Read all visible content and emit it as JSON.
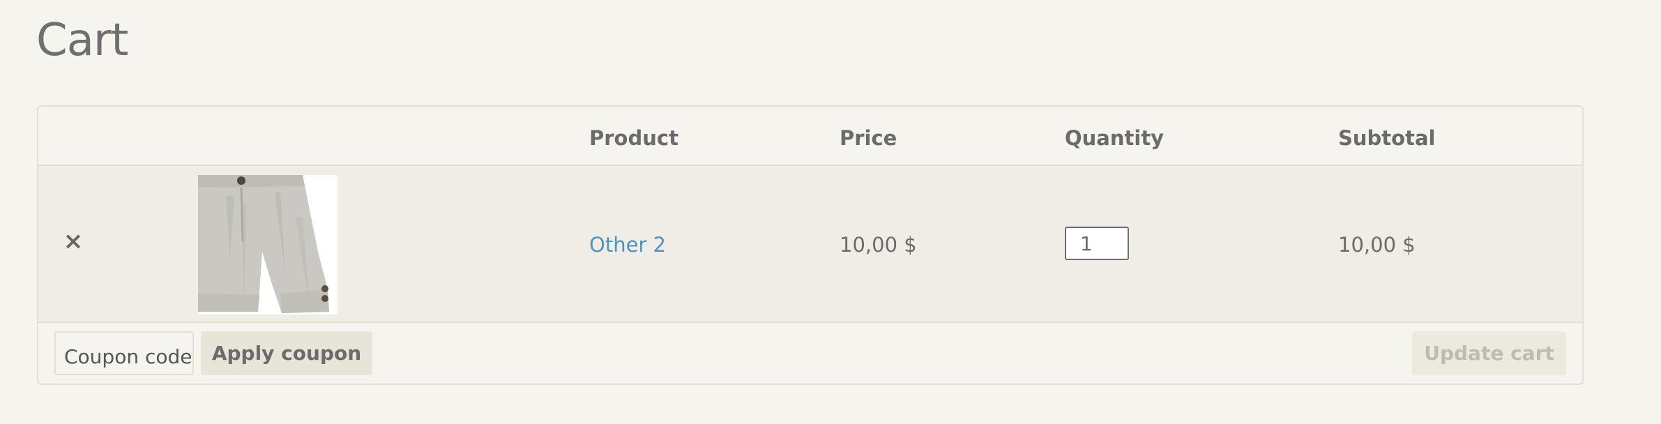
{
  "page": {
    "title": "Cart"
  },
  "cart_table": {
    "headers": {
      "product": "Product",
      "price": "Price",
      "quantity": "Quantity",
      "subtotal": "Subtotal"
    },
    "rows": [
      {
        "remove_icon": "close-icon",
        "remove_glyph": "×",
        "thumbnail": "shorts-product-image",
        "product_name": "Other 2",
        "price": "10,00 $",
        "quantity": "1",
        "subtotal": "10,00 $"
      }
    ]
  },
  "actions": {
    "coupon_placeholder": "Coupon code",
    "apply_coupon_label": "Apply coupon",
    "update_cart_label": "Update cart"
  },
  "colors": {
    "background": "#f5f4ee",
    "row_background": "#efede5",
    "border": "#e2e1cf",
    "link": "#4f93bf",
    "text": "#6b6b6b",
    "disabled_text": "#bdbcae"
  }
}
